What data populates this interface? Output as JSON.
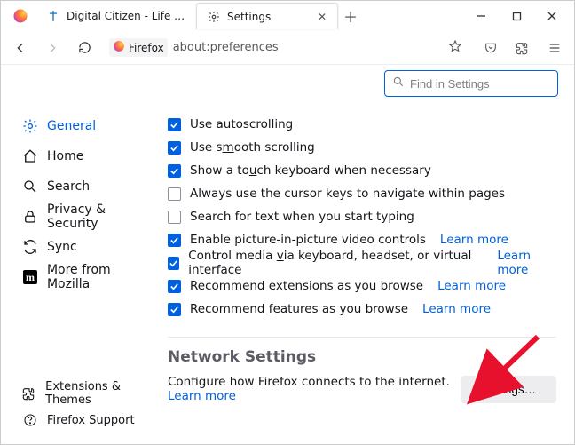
{
  "titlebar": {
    "tabs": [
      {
        "label": "Digital Citizen - Life in a digital"
      },
      {
        "label": "Settings"
      }
    ]
  },
  "toolbar": {
    "url_prefix": "Firefox",
    "url": "about:preferences"
  },
  "search": {
    "placeholder": "Find in Settings"
  },
  "sidebar": {
    "items": [
      {
        "label": "General"
      },
      {
        "label": "Home"
      },
      {
        "label": "Search"
      },
      {
        "label": "Privacy & Security"
      },
      {
        "label": "Sync"
      },
      {
        "label": "More from Mozilla"
      }
    ],
    "bottom": [
      {
        "label": "Extensions & Themes"
      },
      {
        "label": "Firefox Support"
      }
    ]
  },
  "options": {
    "o1": "Use autoscrolling",
    "o2_pre": "Use s",
    "o2_u": "m",
    "o2_post": "ooth scrolling",
    "o3_pre": "Show a to",
    "o3_u": "u",
    "o3_post": "ch keyboard when necessary",
    "o4": "Always use the cursor keys to navigate within pages",
    "o5": "Search for text when you start typing",
    "o6": "Enable picture-in-picture video controls",
    "o7_pre": "Control media ",
    "o7_u": "v",
    "o7_post": "ia keyboard, headset, or virtual interface",
    "o8": "Recommend extensions as you browse",
    "o9_pre": "Recommend ",
    "o9_u": "f",
    "o9_post": "eatures as you browse",
    "learn_more": "Learn more"
  },
  "network": {
    "title": "Network Settings",
    "desc": "Configure how Firefox connects to the internet.",
    "learn_more": "Learn more",
    "button": "Settings…"
  }
}
